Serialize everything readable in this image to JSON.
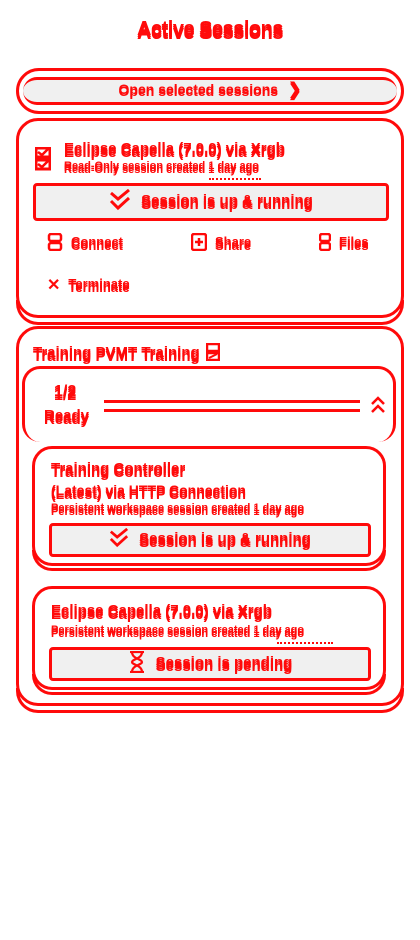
{
  "page": {
    "title": "Active Sessions"
  },
  "open_button": {
    "label": "Open selected sessions"
  },
  "session1": {
    "title": "Eclipse Capella (7.0.0) via Xrgb",
    "subtitle": "Read-Only session created 1 day ago",
    "status": "Session is up & running",
    "actions": [
      {
        "label": "Connect",
        "icon": "connect-icon"
      },
      {
        "label": "Share",
        "icon": "share-icon"
      },
      {
        "label": "Files",
        "icon": "files-icon"
      },
      {
        "label": "Terminate",
        "icon": "close-icon"
      }
    ]
  },
  "group": {
    "title": "Training PVMT Training",
    "progress_count": "1/2",
    "progress_fraction": 0.5,
    "state": "Ready",
    "sessions": [
      {
        "title": "Training Controller",
        "subtitle_line1": "(Latest) via HTTP Connection",
        "subtitle_line2": "Persistent workspace session created 1 day ago",
        "status": "Session is up & running",
        "status_icon": "double-check-icon"
      },
      {
        "title": "Eclipse Capella (7.0.0) via Xrgb",
        "subtitle_line1": "Persistent workspace session created 1 day ago",
        "status": "Session is pending",
        "status_icon": "hourglass-icon"
      }
    ]
  },
  "colors": {
    "accent": "#ff0a0a",
    "bar_bg": "#f0f0f0"
  }
}
